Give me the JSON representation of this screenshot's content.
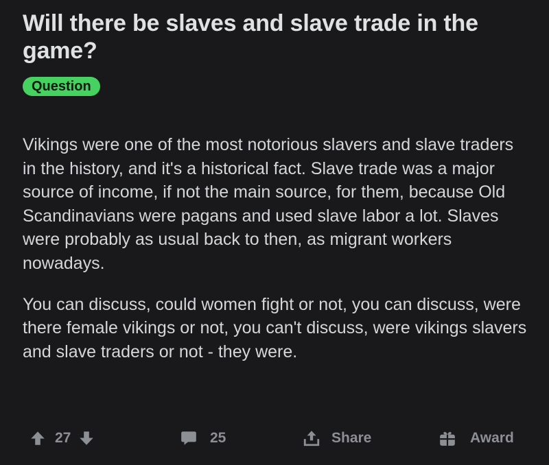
{
  "post": {
    "title": "Will there be slaves and slave trade in the game?",
    "flair": "Question",
    "flair_color": "#46d160",
    "paragraphs": [
      "Vikings were one of the most notorious slavers and slave traders in the history, and it's a historical fact. Slave trade was a major source of income, if not the main source, for them, because Old Scandinavians were pagans and used slave labor a lot. Slaves were probably as usual back to then, as migrant workers nowadays.",
      "You can discuss, could women fight or not, you can discuss, were there female vikings or not, you can't discuss, were vikings slavers and slave traders or not - they were."
    ]
  },
  "actions": {
    "vote_count": "27",
    "comment_count": "25",
    "share_label": "Share",
    "award_label": "Award",
    "icons": {
      "upvote": "arrow-up-icon",
      "downvote": "arrow-down-icon",
      "comment": "comment-bubble-icon",
      "share": "share-upload-icon",
      "award": "gift-award-icon"
    },
    "icon_color": "#8c8f93"
  }
}
